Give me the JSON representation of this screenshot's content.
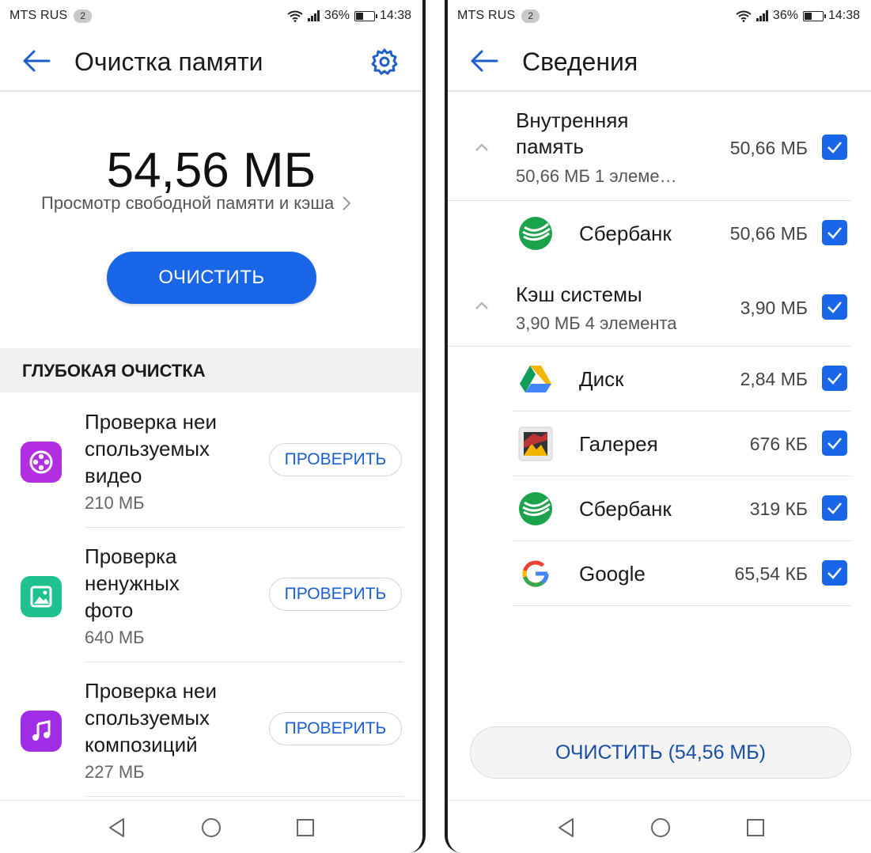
{
  "status_bar": {
    "carrier": "MTS RUS",
    "sim": "2",
    "battery": "36%",
    "battery_level": 0.36,
    "time": "14:38"
  },
  "left": {
    "title": "Очистка памяти",
    "total_size": "54,56 МБ",
    "subtitle": "Просмотр свободной памяти и кэша",
    "clean_button": "ОЧИСТИТЬ",
    "section_title": "ГЛУБОКАЯ ОЧИСТКА",
    "items": [
      {
        "icon": "video-reel-icon",
        "color": "#b22ee0",
        "lines": [
          "Проверка неи",
          "спользуемых",
          "видео"
        ],
        "size": "210 МБ",
        "button": "ПРОВЕРИТЬ"
      },
      {
        "icon": "photo-icon",
        "color": "#1fc28f",
        "lines": [
          "Проверка",
          "ненужных",
          "фото"
        ],
        "size": "640 МБ",
        "button": "ПРОВЕРИТЬ"
      },
      {
        "icon": "music-note-icon",
        "color": "#a12de6",
        "lines": [
          "Проверка неи",
          "спользуемых",
          "композиций"
        ],
        "size": "227 МБ",
        "button": "ПРОВЕРИТЬ"
      }
    ]
  },
  "right": {
    "title": "Сведения",
    "groups": [
      {
        "title_lines": [
          "Внутренняя",
          "память"
        ],
        "sub": "50,66 МБ   1 элеме…",
        "size": "50,66 МБ",
        "apps": [
          {
            "name": "Сбербанк",
            "size": "50,66 МБ",
            "icon": "sberbank-icon"
          }
        ]
      },
      {
        "title_lines": [
          "Кэш системы"
        ],
        "sub": "3,90 МБ   4 элемента",
        "size": "3,90 МБ",
        "apps": [
          {
            "name": "Диск",
            "size": "2,84 МБ",
            "icon": "google-drive-icon"
          },
          {
            "name": "Галерея",
            "size": "676 КБ",
            "icon": "gallery-icon"
          },
          {
            "name": "Сбербанк",
            "size": "319 КБ",
            "icon": "sberbank-icon"
          },
          {
            "name": "Google",
            "size": "65,54 КБ",
            "icon": "google-icon"
          }
        ]
      }
    ],
    "clean_button": "ОЧИСТИТЬ (54,56 МБ)"
  },
  "colors": {
    "accent": "#1a66e8",
    "link": "#1a5fd0"
  }
}
